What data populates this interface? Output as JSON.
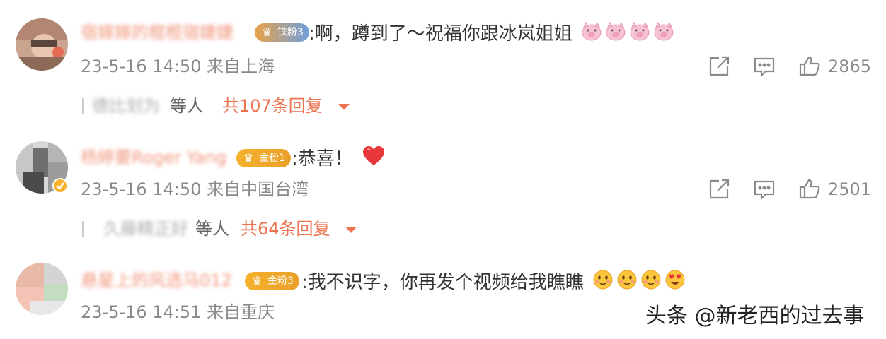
{
  "comments": [
    {
      "username": "宿嫁嫁的棍棍宿婕婕",
      "badge": "铁粉3",
      "text": ":啊，蹲到了～祝福你跟冰岚姐姐",
      "emoji_icons": [
        "pig-face-icon",
        "pig-face-icon",
        "pig-face-icon",
        "pig-face-icon"
      ],
      "time": "23-5-16 14:50",
      "location": "来自上海",
      "likes": "2865",
      "replies_people": "德比划为",
      "replies_suffix": "等人",
      "replies_count": "共107条回复"
    },
    {
      "username": "杨婷要Roger Yang",
      "badge": "金粉1",
      "text": ":恭喜！",
      "emoji_icons": [
        "red-heart-icon"
      ],
      "time": "23-5-16 14:50",
      "location": "来自中国台湾",
      "likes": "2501",
      "replies_people": "久藤精正好",
      "replies_suffix": "等人",
      "replies_count": "共64条回复"
    },
    {
      "username": "悬星上的风选马012",
      "badge": "金粉3",
      "text": ":我不识字，你再发个视频给我瞧瞧",
      "emoji_icons": [
        "blush-face-icon",
        "blush-face-icon",
        "blush-face-icon",
        "heart-eyes-face-icon"
      ],
      "time": "23-5-16 14:51",
      "location": "来自重庆"
    }
  ],
  "watermark": "头条 @新老西的过去事",
  "colors": {
    "accent": "#eb7350",
    "meta": "#8a8a8a",
    "badge_iron": "#6f9edb",
    "badge_gold": "#f6b12d"
  },
  "action_icons": [
    "share-icon",
    "comment-icon",
    "like-icon"
  ]
}
